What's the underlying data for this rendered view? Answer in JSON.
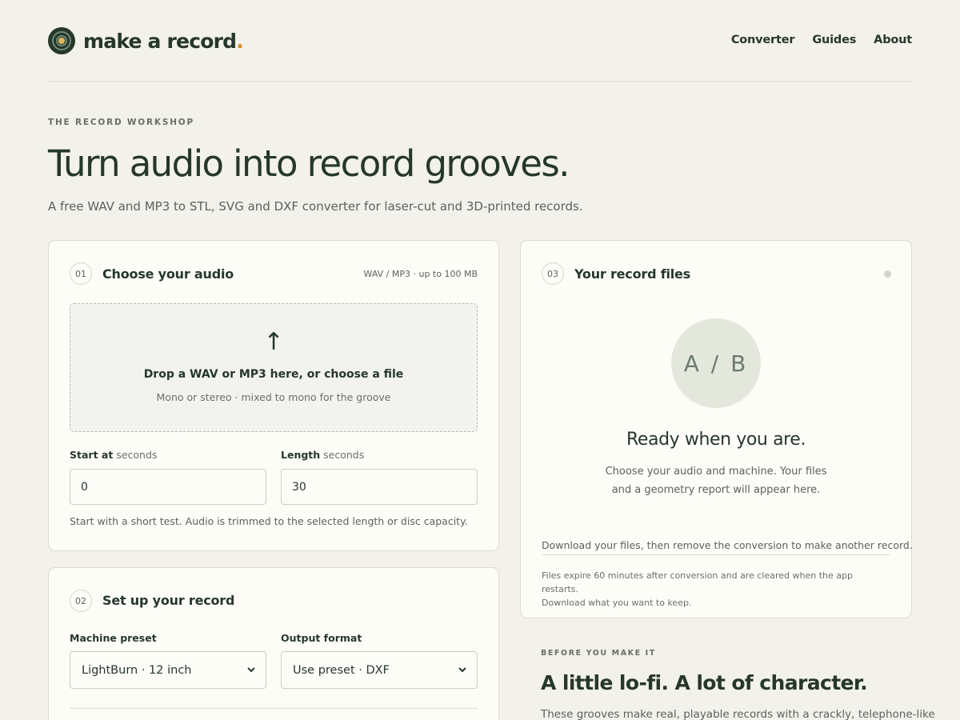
{
  "brand": {
    "name": "make a record",
    "dot": "."
  },
  "nav": [
    "Converter",
    "Guides",
    "About"
  ],
  "hero": {
    "eyebrow": "THE RECORD WORKSHOP",
    "title": "Turn audio into record grooves.",
    "subtitle": "A free WAV and MP3 to STL, SVG and DXF converter for laser-cut and 3D-printed records."
  },
  "step1": {
    "num": "01",
    "title": "Choose your audio",
    "meta": "WAV / MP3 · up to 100 MB",
    "drop_icon": "upload-arrow-icon",
    "drop_title": "Drop a WAV or MP3 here, or choose a file",
    "drop_sub": "Mono or stereo · mixed to mono for the groove",
    "start_label": "Start at",
    "start_unit": "seconds",
    "start_value": "0",
    "length_label": "Length",
    "length_unit": "seconds",
    "length_value": "30",
    "hint": "Start with a short test. Audio is trimmed to the selected length or disc capacity."
  },
  "step2": {
    "num": "02",
    "title": "Set up your record",
    "preset_label": "Machine preset",
    "preset_value": "LightBurn · 12 inch",
    "format_label": "Output format",
    "format_value": "Use preset · DXF"
  },
  "step3": {
    "num": "03",
    "title": "Your record files",
    "placeholder": "A / B",
    "ready": "Ready when you are.",
    "ready_sub_1": "Choose your audio and machine. Your files",
    "ready_sub_2": "and a geometry report will appear here.",
    "download_note": "Download your files, then remove the conversion to make another record.",
    "expire_1": "Files expire 60 minutes after conversion and are cleared when the app restarts.",
    "expire_2": "Download what you want to keep."
  },
  "before": {
    "eyebrow": "BEFORE YOU MAKE IT",
    "title": "A little lo-fi. A lot of character.",
    "body": "These grooves make real, playable records with a crackly, telephone-like"
  },
  "colors": {
    "background": "#f3f1eb",
    "card": "#fdfdf8",
    "ink": "#26372b",
    "accent": "#d28b2c"
  }
}
